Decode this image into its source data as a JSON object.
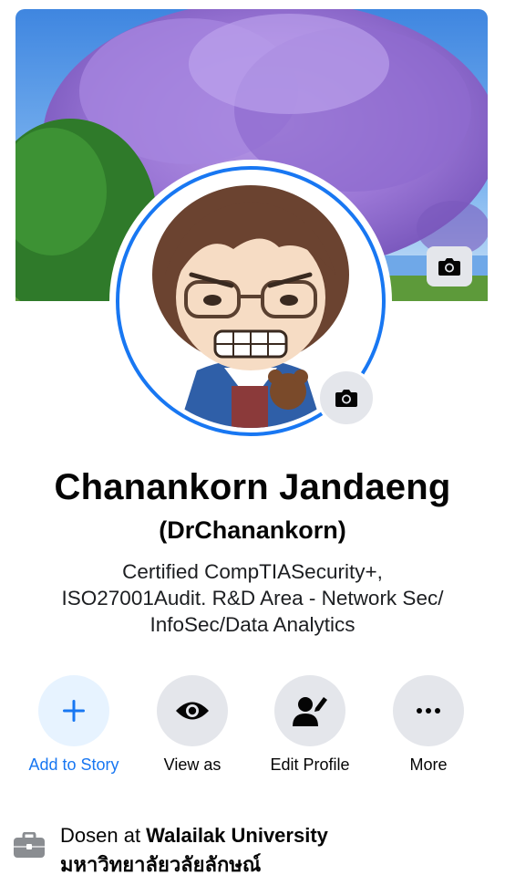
{
  "profile": {
    "name": "Chanankorn Jandaeng",
    "alternate_name": "(DrChanankorn)",
    "bio_lines": [
      "Certified CompTIASecurity+,",
      "ISO27001Audit.  R&D Area - Network Sec/",
      "InfoSec/Data Analytics"
    ]
  },
  "actions": [
    {
      "label": "Add to Story",
      "icon": "plus-icon"
    },
    {
      "label": "View as",
      "icon": "eye-icon"
    },
    {
      "label": "Edit Profile",
      "icon": "edit-person-icon"
    },
    {
      "label": "More",
      "icon": "more-dots-icon"
    }
  ],
  "work": {
    "prefix": "Dosen at ",
    "company": "Walailak University",
    "company_local": "มหาวิทยาลัยวลัยลักษณ์",
    "icon": "briefcase-icon"
  },
  "colors": {
    "accent": "#1877f2",
    "button_bg": "#e4e6eb",
    "accent_light": "#e7f3ff"
  }
}
